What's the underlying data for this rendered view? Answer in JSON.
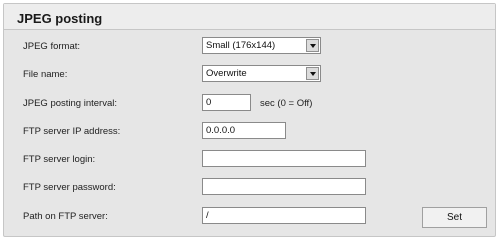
{
  "panel": {
    "title": "JPEG posting"
  },
  "fields": {
    "jpeg_format": {
      "label": "JPEG format:",
      "value": "Small (176x144)"
    },
    "file_name": {
      "label": "File name:",
      "value": "Overwrite"
    },
    "posting_interval": {
      "label": "JPEG posting interval:",
      "value": "0",
      "suffix": "sec (0 = Off)"
    },
    "ftp_ip": {
      "label": "FTP server IP address:",
      "value": "0.0.0.0"
    },
    "ftp_login": {
      "label": "FTP server login:",
      "value": ""
    },
    "ftp_password": {
      "label": "FTP server password:",
      "value": ""
    },
    "ftp_path": {
      "label": "Path on FTP server:",
      "value": "/"
    }
  },
  "actions": {
    "set_label": "Set"
  }
}
